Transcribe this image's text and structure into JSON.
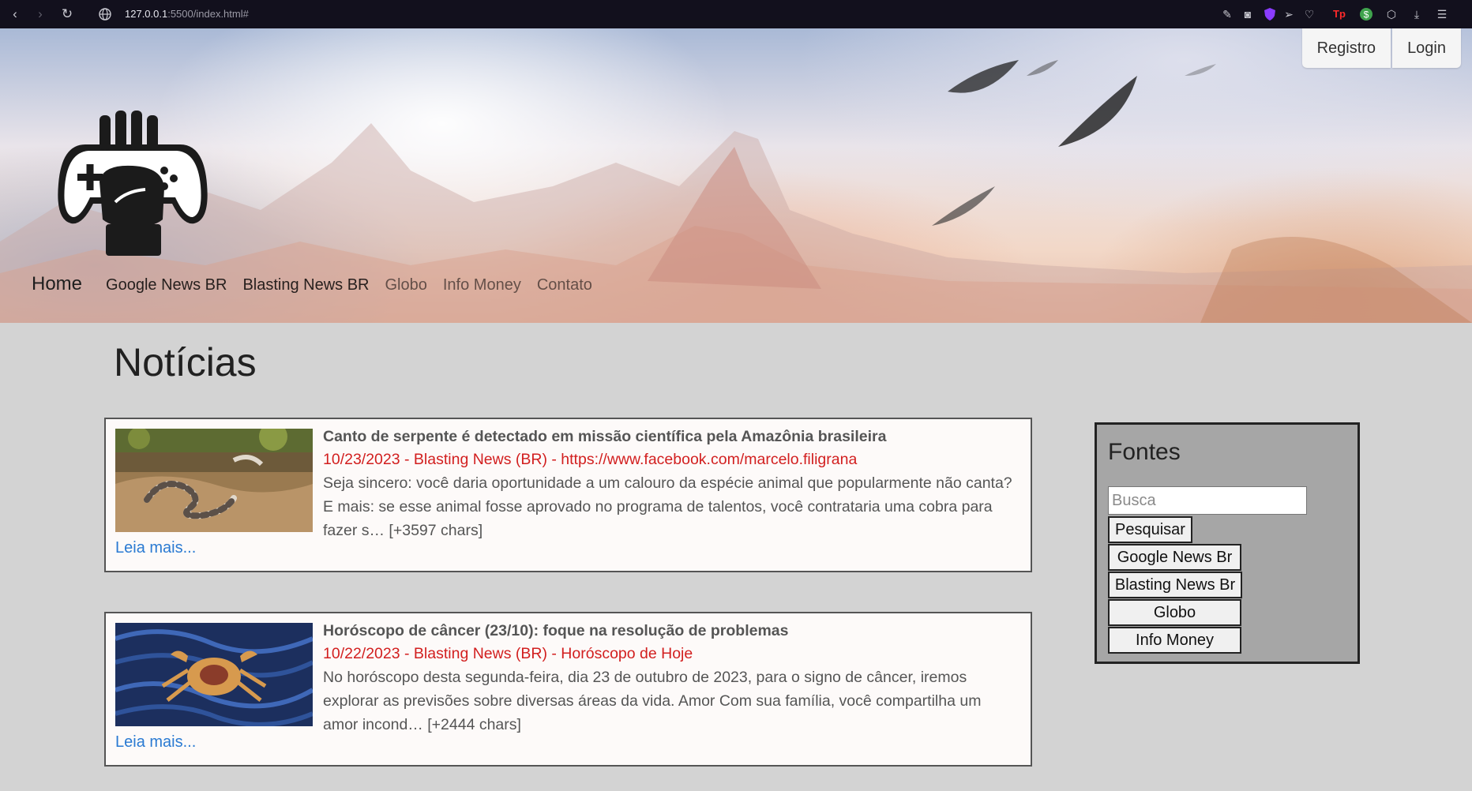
{
  "browser": {
    "url_host": "127.0.0.1",
    "url_path": ":5500/index.html#",
    "nav_icons": [
      "back-icon",
      "forward-icon",
      "reload-icon",
      "globe-icon"
    ],
    "extension_icons": [
      "edit-icon",
      "camera-icon",
      "shield-icon",
      "send-icon",
      "heart-icon",
      "tp-icon",
      "dollar-icon",
      "cube-icon",
      "download-icon",
      "menu-icon"
    ]
  },
  "header": {
    "logo_icon": "gamepad-hand-icon",
    "auth": {
      "register": "Registro",
      "login": "Login"
    },
    "brand": "Home",
    "nav": [
      "Google News BR",
      "Blasting News BR",
      "Globo",
      "Info Money",
      "Contato"
    ]
  },
  "main": {
    "title": "Notícias",
    "articles": [
      {
        "title": "Canto de serpente é detectado em missão científica pela Amazônia brasileira",
        "meta": "10/23/2023 - Blasting News (BR) - https://www.facebook.com/marcelo.filigrana",
        "desc": "Seja sincero: você daria oportunidade a um calouro da espécie animal que popularmente não canta? E mais: se esse animal fosse aprovado no programa de talentos, você contrataria uma cobra para fazer s… [+3597 chars]",
        "more": "Leia mais...",
        "image": "snake-photo"
      },
      {
        "title": "Horóscopo de câncer (23/10): foque na resolução de problemas",
        "meta": "10/22/2023 - Blasting News (BR) - Horóscopo de Hoje",
        "desc": "No horóscopo desta segunda-feira, dia 23 de outubro de 2023, para o signo de câncer, iremos explorar as previsões sobre diversas áreas da vida. Amor Com sua família, você compartilha um amor incond… [+2444 chars]",
        "more": "Leia mais...",
        "image": "crab-illustration"
      }
    ]
  },
  "sidebar": {
    "title": "Fontes",
    "search_placeholder": "Busca",
    "search_button": "Pesquisar",
    "sources": [
      "Google News Br",
      "Blasting News Br",
      "Globo",
      "Info Money"
    ]
  },
  "colors": {
    "chrome_bg": "#12101d",
    "page_bg": "#d3d3d3",
    "meta_red": "#d21f1f",
    "link_blue": "#2a7ad2",
    "sidebar_bg": "#a6a6a6"
  }
}
